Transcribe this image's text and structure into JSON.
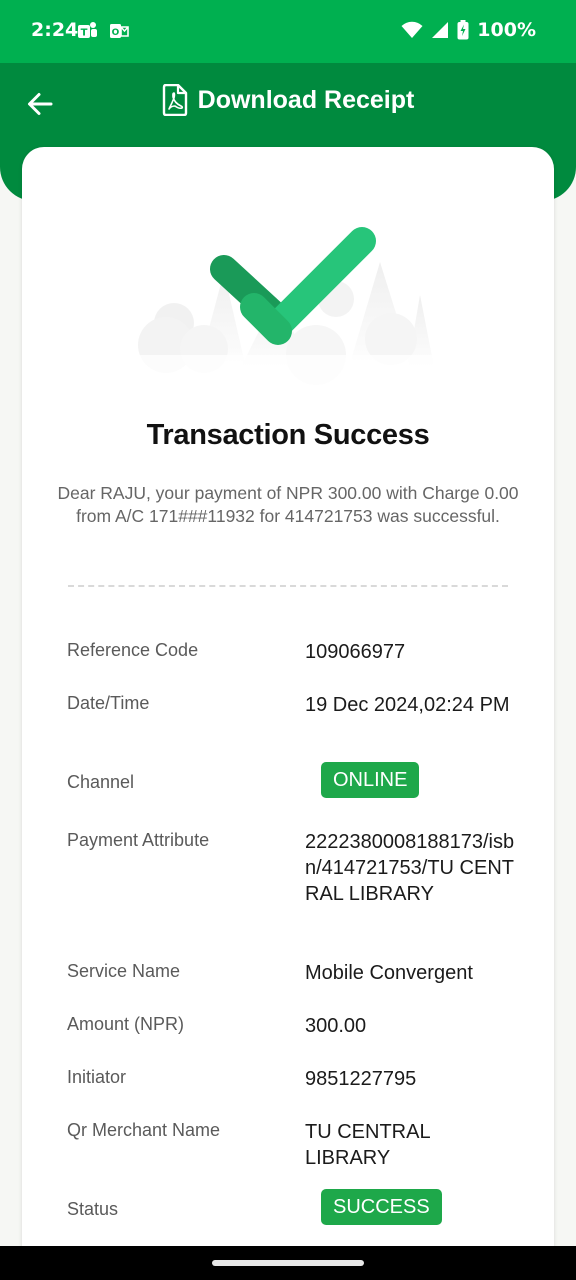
{
  "status_bar": {
    "time": "2:24",
    "battery": "100%",
    "icons": [
      "teams-icon",
      "outlook-icon",
      "wifi-icon",
      "cell-signal-icon",
      "battery-charging-icon"
    ]
  },
  "header": {
    "title": "Download Receipt",
    "back_icon": "arrow-left-icon",
    "title_icon": "pdf-file-icon"
  },
  "result": {
    "title": "Transaction Success",
    "message": "Dear RAJU, your payment of NPR 300.00 with Charge 0.00 from A/C 171###11932 for 414721753 was successful."
  },
  "details": [
    {
      "label": "Reference Code",
      "value": "109066977"
    },
    {
      "label": "Date/Time",
      "value": "19 Dec 2024,02:24 PM"
    },
    {
      "label": "Channel",
      "value": "ONLINE",
      "badge": true
    },
    {
      "label": "Payment Attribute",
      "value": "2222380008188173/isbn/414721753/TU CENTRAL LIBRARY"
    },
    {
      "label": "Service Name",
      "value": "Mobile Convergent"
    },
    {
      "label": "Amount (NPR)",
      "value": "300.00"
    },
    {
      "label": "Initiator",
      "value": "9851227795"
    },
    {
      "label": "Qr Merchant Name",
      "value": "TU CENTRAL LIBRARY"
    },
    {
      "label": "Status",
      "value": "SUCCESS",
      "badge": true
    }
  ],
  "colors": {
    "status_bar": "#00b050",
    "header": "#008a3e",
    "badge": "#1ea84a",
    "check_light": "#27c57a",
    "check_dark": "#1a9a58"
  }
}
